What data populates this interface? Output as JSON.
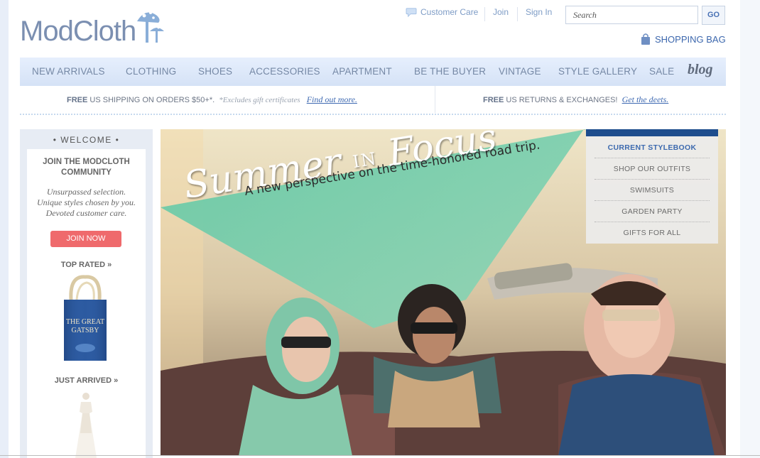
{
  "header": {
    "logo_text": "ModCloth",
    "customer_care": "Customer Care",
    "join": "Join",
    "sign_in": "Sign In",
    "search_placeholder": "Search",
    "go_label": "GO",
    "shopping_bag": "SHOPPING BAG"
  },
  "nav": {
    "items": [
      "NEW ARRIVALS",
      "CLOTHING",
      "SHOES",
      "ACCESSORIES",
      "APARTMENT",
      "BE THE BUYER",
      "VINTAGE",
      "STYLE GALLERY",
      "SALE"
    ],
    "blog": "blog"
  },
  "shipping": {
    "free1": "FREE",
    "text1": "US SHIPPING ON ORDERS $50+*.",
    "note1": "*Excludes gift certificates",
    "link1": "Find out more.",
    "free2": "FREE",
    "text2": "US RETURNS & EXCHANGES!",
    "link2": "Get the deets."
  },
  "sidebar": {
    "welcome": "•  WELCOME  •",
    "title_line1": "JOIN THE MODCLOTH",
    "title_line2": "COMMUNITY",
    "tag_line1": "Unsurpassed selection.",
    "tag_line2": "Unique styles chosen by you.",
    "tag_line3": "Devoted customer care.",
    "join_button": "JOIN NOW",
    "top_rated": "TOP RATED »",
    "tote_text_1": "THE GREAT",
    "tote_text_2": "GATSBY",
    "just_arrived": "JUST ARRIVED »"
  },
  "hero": {
    "title_part1": "Summer",
    "title_in": "IN",
    "title_part2": "Focus",
    "subtitle": "A new perspective on the time-honored road trip."
  },
  "stylebook": {
    "links": [
      "CURRENT STYLEBOOK",
      "SHOP OUR OUTFITS",
      "SWIMSUITS",
      "GARDEN PARTY",
      "GIFTS FOR ALL"
    ]
  },
  "colors": {
    "brand_blue": "#3c67ad",
    "nav_bg": "#dce7f8",
    "join_red": "#ef6a6c",
    "stylebook_bar": "#1e4d8d"
  }
}
